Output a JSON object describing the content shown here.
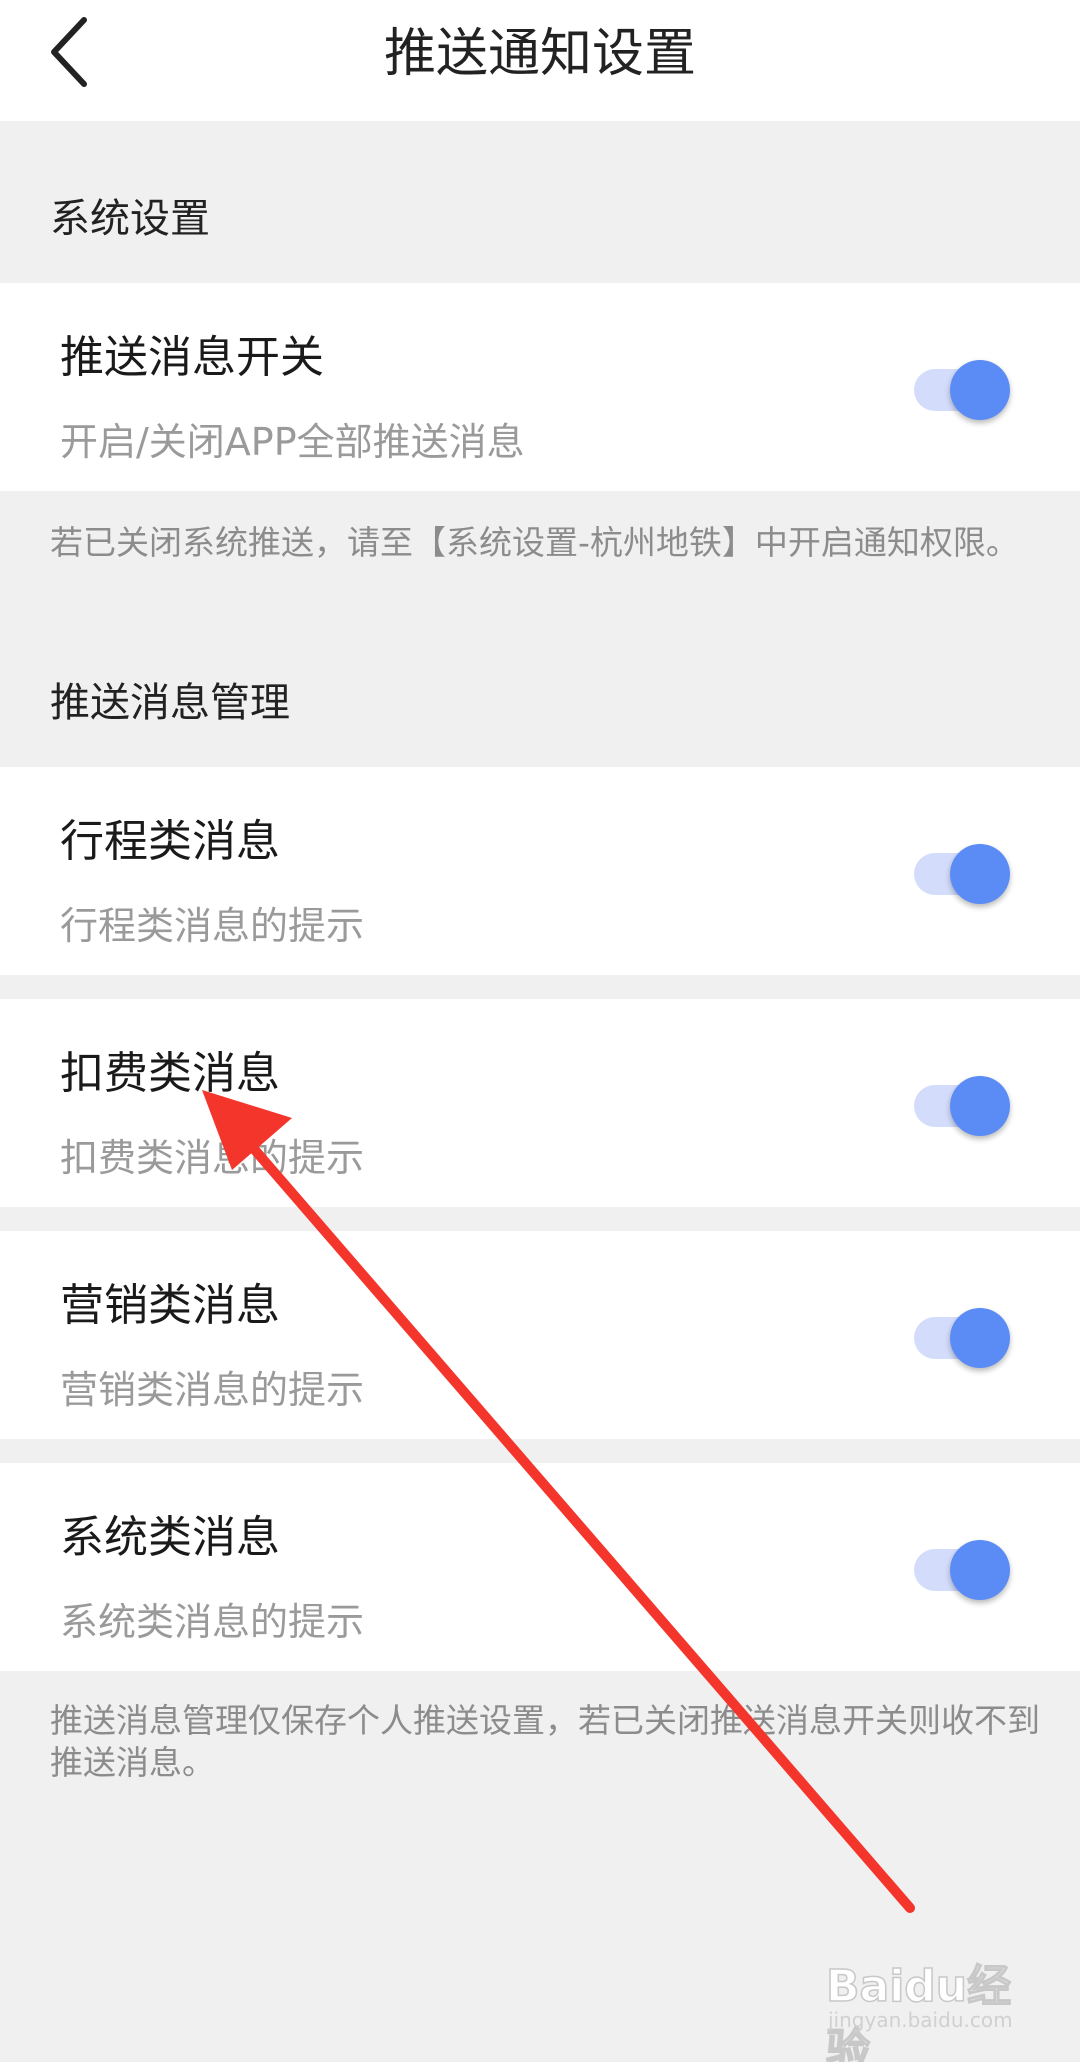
{
  "header": {
    "title": "推送通知设置",
    "back_icon": "chevron-left-icon"
  },
  "sections": {
    "system": {
      "title": "系统设置"
    },
    "manage": {
      "title": "推送消息管理"
    }
  },
  "master": {
    "title": "推送消息开关",
    "subtitle": "开启/关闭APP全部推送消息",
    "enabled": true
  },
  "system_note": "若已关闭系统推送，请至【系统设置-杭州地铁】中开启通知权限。",
  "categories": [
    {
      "title": "行程类消息",
      "subtitle": "行程类消息的提示",
      "enabled": true
    },
    {
      "title": "扣费类消息",
      "subtitle": "扣费类消息的提示",
      "enabled": true
    },
    {
      "title": "营销类消息",
      "subtitle": "营销类消息的提示",
      "enabled": true
    },
    {
      "title": "系统类消息",
      "subtitle": "系统类消息的提示",
      "enabled": true
    }
  ],
  "manage_note": "推送消息管理仅保存个人推送设置，若已关闭推送消息开关则收不到推送消息。",
  "colors": {
    "accent": "#5b8cf5",
    "track": "#d3dcfb",
    "annotation_arrow": "#f4352b"
  },
  "watermark": {
    "brand": "Baidu经验",
    "url": "jingyan.baidu.com"
  }
}
